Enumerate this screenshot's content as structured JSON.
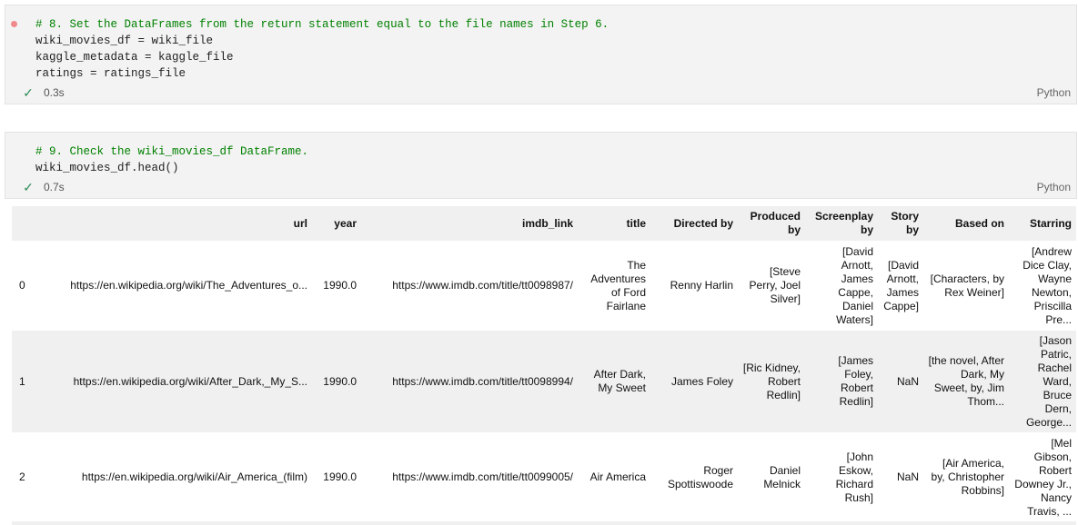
{
  "cells": [
    {
      "comment": "# 8. Set the DataFrames from the return statement equal to the file names in Step 6.",
      "lines": [
        "wiki_movies_df = wiki_file",
        "kaggle_metadata = kaggle_file",
        "ratings = ratings_file"
      ],
      "time": "0.3s",
      "language": "Python"
    },
    {
      "comment": "# 9. Check the wiki_movies_df DataFrame.",
      "lines": [
        "wiki_movies_df.head()"
      ],
      "time": "0.7s",
      "language": "Python"
    }
  ],
  "dataframe": {
    "columns": [
      "",
      "url",
      "year",
      "imdb_link",
      "title",
      "Directed by",
      "Produced by",
      "Screenplay by",
      "Story by",
      "Based on",
      "Starring"
    ],
    "rows": [
      {
        "index": "0",
        "url": "https://en.wikipedia.org/wiki/The_Adventures_o...",
        "year": "1990.0",
        "imdb_link": "https://www.imdb.com/title/tt0098987/",
        "title": "The Adventures of Ford Fairlane",
        "directed_by": "Renny Harlin",
        "produced_by": "[Steve Perry, Joel Silver]",
        "screenplay_by": "[David Arnott, James Cappe, Daniel Waters]",
        "story_by": "[David Arnott, James Cappe]",
        "based_on": "[Characters, by Rex Weiner]",
        "starring": "[Andrew Dice Clay, Wayne Newton, Priscilla Pre..."
      },
      {
        "index": "1",
        "url": "https://en.wikipedia.org/wiki/After_Dark,_My_S...",
        "year": "1990.0",
        "imdb_link": "https://www.imdb.com/title/tt0098994/",
        "title": "After Dark, My Sweet",
        "directed_by": "James Foley",
        "produced_by": "[Ric Kidney, Robert Redlin]",
        "screenplay_by": "[James Foley, Robert Redlin]",
        "story_by": "NaN",
        "based_on": "[the novel, After Dark, My Sweet, by, Jim Thom...",
        "starring": "[Jason Patric, Rachel Ward, Bruce Dern, George..."
      },
      {
        "index": "2",
        "url": "https://en.wikipedia.org/wiki/Air_America_(film)",
        "year": "1990.0",
        "imdb_link": "https://www.imdb.com/title/tt0099005/",
        "title": "Air America",
        "directed_by": "Roger Spottiswoode",
        "produced_by": "Daniel Melnick",
        "screenplay_by": "[John Eskow, Richard Rush]",
        "story_by": "NaN",
        "based_on": "[Air America, by, Christopher Robbins]",
        "starring": "[Mel Gibson, Robert Downey Jr., Nancy Travis, ..."
      }
    ]
  }
}
